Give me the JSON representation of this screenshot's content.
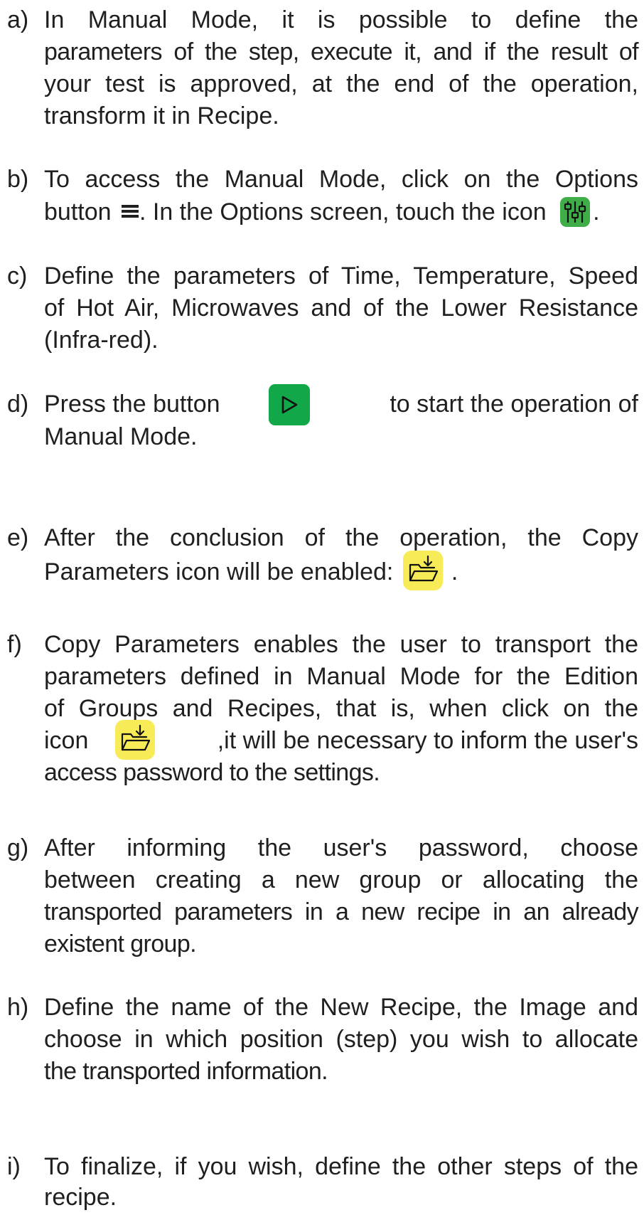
{
  "items": [
    {
      "marker": "a)",
      "lines": [
        "In Manual Mode, it is possible to define the",
        "parameters of the step, execute it, and if the result of",
        "your test is approved, at the end of the operation,",
        "transform it in Recipe."
      ]
    },
    {
      "marker": "b)",
      "lines": [
        "To access the Manual Mode, click on the Options",
        "button",
        ". In the Options screen, touch the icon",
        "."
      ]
    },
    {
      "marker": "c)",
      "lines": [
        "Define the parameters of Time, Temperature, Speed",
        "of Hot Air, Microwaves and of the Lower Resistance",
        "(Infra-red)."
      ]
    },
    {
      "marker": "d)",
      "lines": [
        "Press the button",
        "to start the operation of",
        "Manual Mode."
      ]
    },
    {
      "marker": "e)",
      "lines": [
        "After the conclusion of the operation, the Copy",
        "Parameters icon will be enabled:",
        "."
      ]
    },
    {
      "marker": "f)",
      "lines": [
        "Copy Parameters enables the user to transport the",
        "parameters defined in Manual Mode for the Edition",
        "of Groups and Recipes, that is, when click on the",
        "icon",
        ",it will be necessary to inform the user's",
        "access password to the settings."
      ]
    },
    {
      "marker": "g)",
      "lines": [
        "After informing the user's password, choose",
        "between creating a new group or allocating the",
        "transported parameters in a new recipe in an already",
        "existent group."
      ]
    },
    {
      "marker": "h)",
      "lines": [
        "Define the name of the New Recipe, the Image and",
        "choose in which position (step) you wish to allocate",
        "the transported information."
      ]
    },
    {
      "marker": "i)",
      "lines": [
        "To finalize, if you wish, define the other steps of the",
        "recipe."
      ]
    }
  ],
  "icons": {
    "options_menu": "menu-icon",
    "manual_mode": "sliders-icon",
    "start": "play-icon",
    "copy_parameters": "folder-download-icon"
  },
  "colors": {
    "green_icon": "#3fae49",
    "play_button": "#12a84a",
    "folder_highlight": "#f7ec57"
  }
}
